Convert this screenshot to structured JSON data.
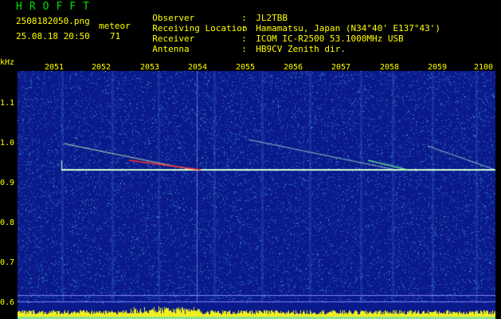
{
  "header": {
    "title": "HROFFT",
    "filename": "2508182050.png",
    "meteor_label": "meteor",
    "datetime": "25.08.18 20:50",
    "meteor_count": "71",
    "info": [
      {
        "label": "Observer",
        "value": "JL2TBB"
      },
      {
        "label": "Receiving Location",
        "value": "Hamamatsu, Japan (N34°40' E137°43')"
      },
      {
        "label": "Receiver",
        "value": "ICOM IC-R2500 53.1000MHz USB"
      },
      {
        "label": "Antenna",
        "value": "HB9CV Zenith dir."
      }
    ]
  },
  "axes": {
    "y_unit": "kHz",
    "y_ticks": [
      "1.1",
      "1.0",
      "0.9",
      "0.8",
      "0.7",
      "0.6"
    ],
    "x_ticks": [
      "2051",
      "2052",
      "2053",
      "2054",
      "2055",
      "2056",
      "2057",
      "2058",
      "2059",
      "2100"
    ]
  },
  "colors": {
    "background": "#0a1a8a",
    "noise_light": "#3d7fe0",
    "noise_cyan": "#30d0d0",
    "trace": "#d0ffd0",
    "meteor": "#ff3030",
    "grid": "#8080ff",
    "bottom_bars": "#f0f020",
    "label": "#ffff00",
    "title": "#00e000"
  }
}
